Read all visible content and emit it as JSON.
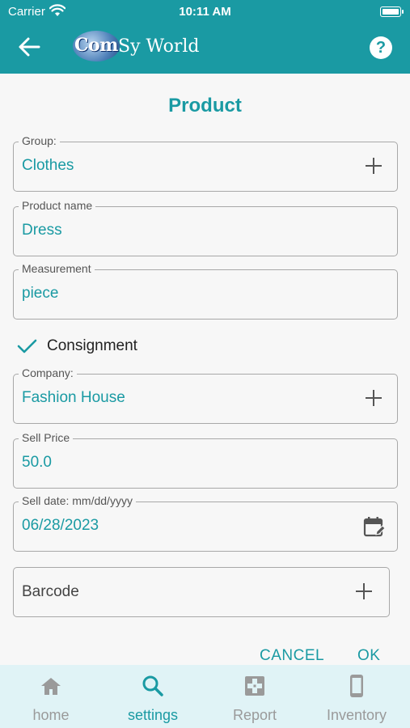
{
  "status_bar": {
    "carrier": "Carrier",
    "time": "10:11 AM"
  },
  "header": {
    "logo_com": "Com",
    "logo_rest": "Sy World",
    "help_label": "?"
  },
  "page": {
    "title": "Product"
  },
  "fields": {
    "group": {
      "label": "Group:",
      "value": "Clothes"
    },
    "product_name": {
      "label": "Product name",
      "value": "Dress"
    },
    "measurement": {
      "label": "Measurement",
      "value": "piece"
    },
    "consignment": {
      "label": "Consignment",
      "checked": true
    },
    "company": {
      "label": "Company:",
      "value": "Fashion House"
    },
    "sell_price": {
      "label": "Sell Price",
      "value": "50.0"
    },
    "sell_date": {
      "label": "Sell date: mm/dd/yyyy",
      "value": "06/28/2023"
    }
  },
  "barcode": {
    "label": "Barcode"
  },
  "actions": {
    "cancel": "CANCEL",
    "ok": "OK"
  },
  "bottom_nav": [
    {
      "label": "home",
      "icon": "home-icon",
      "active": false
    },
    {
      "label": "settings",
      "icon": "search-icon",
      "active": true
    },
    {
      "label": "Report",
      "icon": "report-icon",
      "active": false
    },
    {
      "label": "Inventory",
      "icon": "phone-icon",
      "active": false
    }
  ],
  "colors": {
    "accent": "#1a9aa3",
    "nav_bg": "#e0f3f6",
    "inactive": "#9a9a9a"
  }
}
